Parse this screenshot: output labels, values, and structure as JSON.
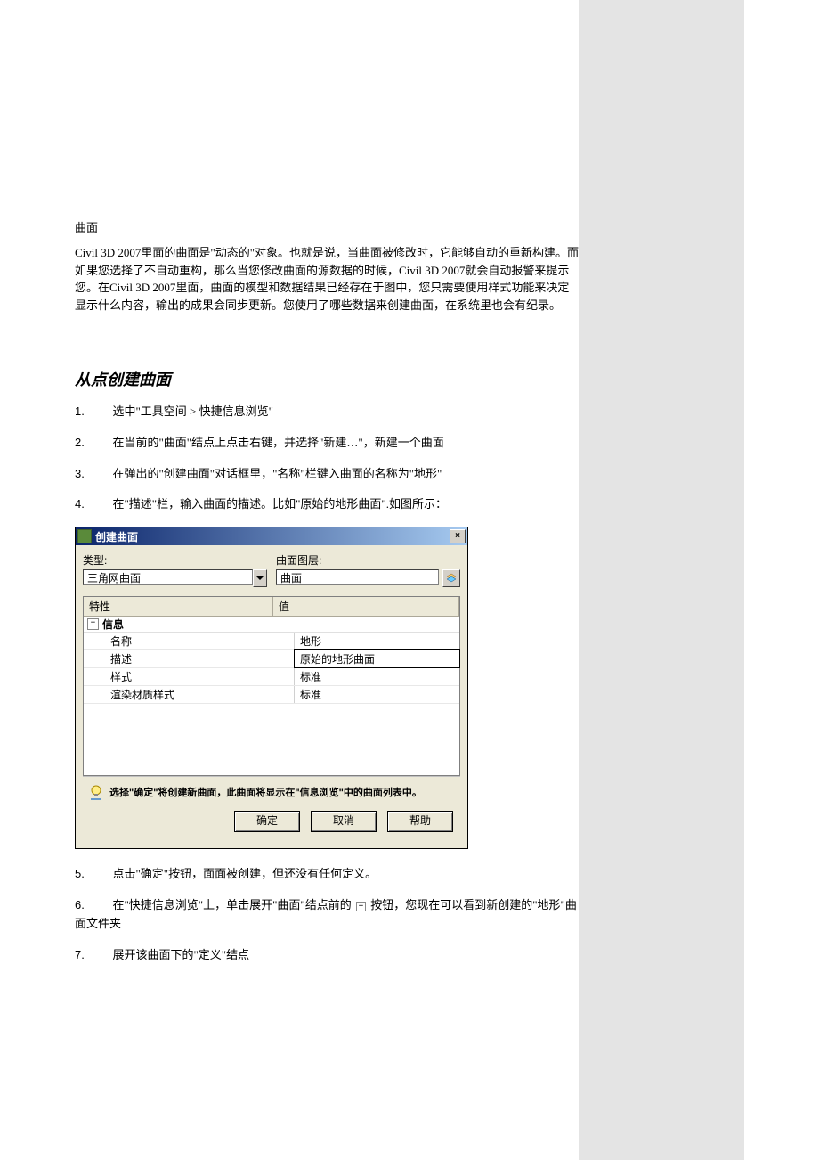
{
  "doc": {
    "section_label": "曲面",
    "intro": "Civil 3D 2007里面的曲面是\"动态的\"对象。也就是说，当曲面被修改时，它能够自动的重新构建。而如果您选择了不自动重构，那么当您修改曲面的源数据的时候，Civil 3D 2007就会自动报警来提示您。在Civil 3D 2007里面，曲面的模型和数据结果已经存在于图中，您只需要使用样式功能来决定显示什么内容，输出的成果会同步更新。您使用了哪些数据来创建曲面，在系统里也会有纪录。",
    "heading": "从点创建曲面",
    "steps_top": [
      "选中\"工具空间 > 快捷信息浏览\"",
      "在当前的\"曲面\"结点上点击右键，并选择\"新建…\"，新建一个曲面",
      "在弹出的\"创建曲面\"对话框里，\"名称\"栏键入曲面的名称为\"地形\"",
      "在\"描述\"栏，输入曲面的描述。比如\"原始的地形曲面\".如图所示："
    ],
    "steps_bottom": [
      "点击\"确定\"按钮，面面被创建，但还没有任何定义。",
      "在\"快捷信息浏览\"上，单击展开\"曲面\"结点前的 ⊞ 按钮，您现在可以看到新创建的\"地形\"曲面文件夹",
      "展开该曲面下的\"定义\"结点"
    ]
  },
  "dialog": {
    "title": "创建曲面",
    "close": "×",
    "type_label": "类型:",
    "type_value": "三角网曲面",
    "layer_label": "曲面图层:",
    "layer_value": "曲面",
    "grid": {
      "header_property": "特性",
      "header_value": "值",
      "group": "信息",
      "rows": [
        {
          "k": "名称",
          "v": "地形"
        },
        {
          "k": "描述",
          "v": "原始的地形曲面"
        },
        {
          "k": "样式",
          "v": "标准"
        },
        {
          "k": "渲染材质样式",
          "v": "标准"
        }
      ]
    },
    "hint": "选择\"确定\"将创建新曲面，此曲面将显示在\"信息浏览\"中的曲面列表中。",
    "buttons": {
      "ok": "确定",
      "cancel": "取消",
      "help": "帮助"
    }
  }
}
